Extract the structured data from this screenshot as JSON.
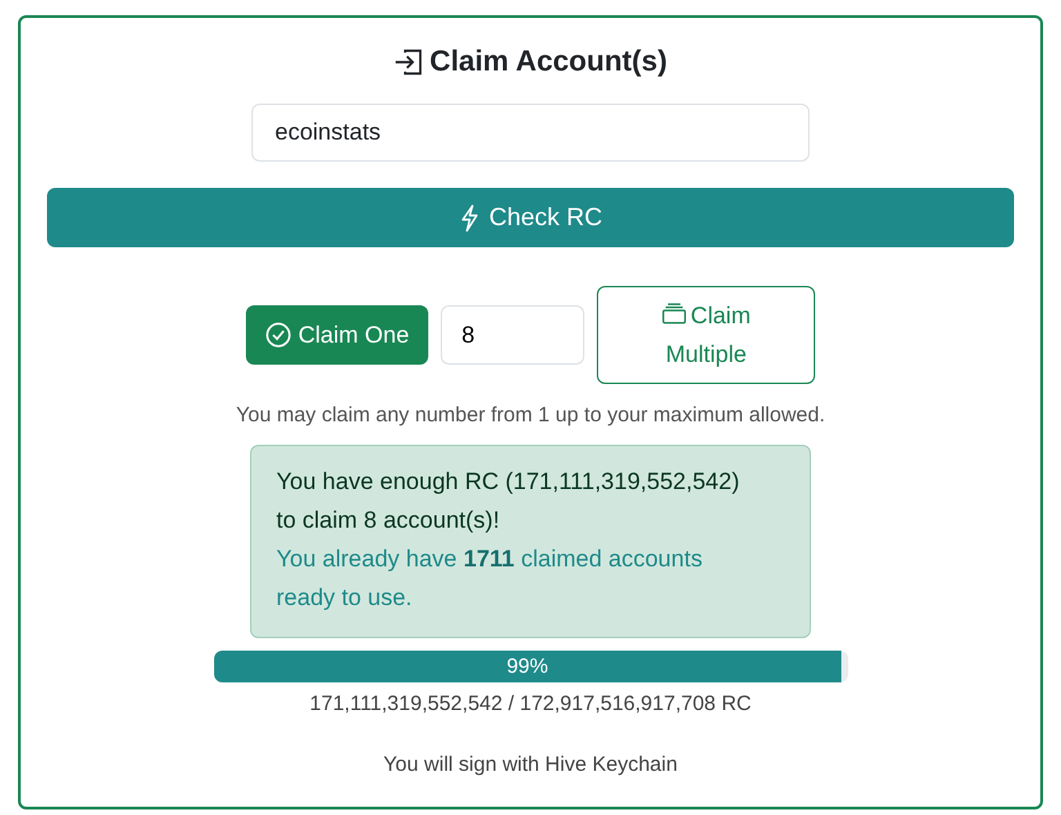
{
  "title": "Claim Account(s)",
  "account_field": {
    "value": "ecoinstats"
  },
  "check_button": {
    "label": "Check RC"
  },
  "claim_one_button": {
    "label": "Claim One"
  },
  "count_field": {
    "value": "8"
  },
  "claim_multiple_button": {
    "label": "Claim Multiple"
  },
  "hint": "You may claim any number from 1 up to your maximum allowed.",
  "alert": {
    "message": "You have enough RC (171,111,319,552,542) to claim 8 account(s)!",
    "note": "You already have **1711** claimed accounts ready to use."
  },
  "progress": {
    "label": "99%",
    "level": 0.99
  },
  "rc_reading": "171,111,319,552,542 / 172,917,516,917,708 RC",
  "footer": "You will sign with Hive Keychain"
}
